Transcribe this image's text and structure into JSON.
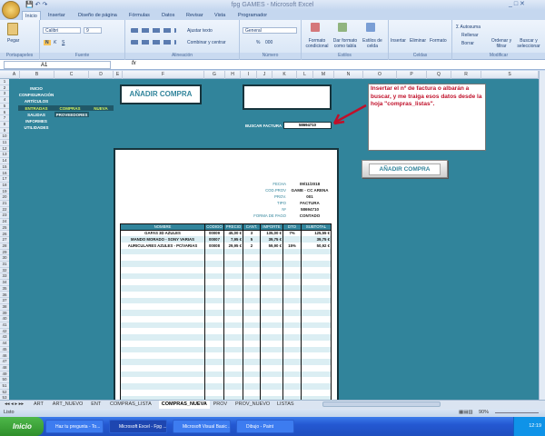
{
  "window": {
    "title": "fpg GAMES - Microsoft Excel"
  },
  "ribbon": {
    "tabs": [
      "Inicio",
      "Insertar",
      "Diseño de página",
      "Fórmulas",
      "Datos",
      "Revisar",
      "Vista",
      "Programador"
    ],
    "active_tab": "Inicio",
    "clipboard": {
      "paste": "Pegar",
      "label": "Portapapeles"
    },
    "font": {
      "name": "Calibri",
      "size": "9",
      "label": "Fuente",
      "bold": "N",
      "italic": "K",
      "underline": "S"
    },
    "alignment": {
      "wrap": "Ajustar texto",
      "merge": "Combinar y centrar",
      "label": "Alineación"
    },
    "number": {
      "format": "General",
      "label": "Número",
      "percent": "%",
      "thousands": "000"
    },
    "styles": {
      "conditional": "Formato condicional",
      "as_table": "Dar formato como tabla",
      "cell_styles": "Estilos de celda",
      "label": "Estilos"
    },
    "cells": {
      "insert": "Insertar",
      "delete": "Eliminar",
      "format": "Formato",
      "label": "Celdas"
    },
    "editing": {
      "autosum": "Autosuma",
      "fill": "Rellenar",
      "clear": "Borrar",
      "sort": "Ordenar y filtrar",
      "find": "Buscar y seleccionar",
      "label": "Modificar"
    }
  },
  "formula_bar": {
    "name_box": "A1",
    "fx": "fx",
    "value": ""
  },
  "columns": [
    "A",
    "B",
    "C",
    "D",
    "E",
    "F",
    "G",
    "H",
    "I",
    "J",
    "K",
    "L",
    "M",
    "N",
    "O",
    "P",
    "Q",
    "R",
    "S"
  ],
  "row_count": 53,
  "menu": {
    "inicio": "INICIO",
    "configuracion": "CONFIGURACIÓN",
    "articulos": "ARTÍCULOS",
    "entradas": "ENTRADAS",
    "compras": "COMPRAS",
    "nueva": "NUEVA",
    "salidas": "SALIDAS",
    "proveedores": "PROVEEDORES",
    "informes": "INFORMES",
    "utilidades": "UTILIDADES"
  },
  "header_button": "AÑADIR COMPRA",
  "search": {
    "label": "BUSCAR FACTURA",
    "value": "58694710"
  },
  "note": "Insertar el nº de factura o albarán a buscar, y me traiga esos datos desde la hoja \"compras_listas\".",
  "add_button": "AÑADIR COMPRA",
  "invoice": {
    "fields": [
      {
        "label": "FECHA",
        "value": "09/11/2018"
      },
      {
        "label": "COD.PROV",
        "value": "GAME - CC ARENA"
      },
      {
        "label": "PROV.",
        "value": "001"
      },
      {
        "label": "TIPO",
        "value": "FACTURA"
      },
      {
        "label": "Nº",
        "value": "58694710"
      },
      {
        "label": "FORMA DE PAGO",
        "value": "CONTADO"
      }
    ],
    "columns": [
      "NOMBRE",
      "CODIGO",
      "PRECIO",
      "CANT.",
      "IMPORTE",
      "DTO",
      "SUBTOTAL"
    ],
    "rows": [
      [
        "GAFAS 3D AZULES",
        "00009",
        "45,00 €",
        "3",
        "135,00 €",
        "7%",
        "125,55 €"
      ],
      [
        "MANDO MORADO - SONY VARIAS",
        "00007",
        "7,95 €",
        "5",
        "39,75 €",
        "",
        "39,75 €"
      ],
      [
        "AURICULARES AZULES - PC/VARIAS",
        "00008",
        "29,95 €",
        "2",
        "59,90 €",
        "15%",
        "50,92 €"
      ]
    ],
    "empty_rows": 26
  },
  "sheet_tabs": [
    "ART",
    "ART_NUEVO",
    "ENT",
    "COMPRAS_LISTA",
    "COMPRAS_NUEVA",
    "PROV",
    "PROV_NUEVO",
    "LISTAS"
  ],
  "active_sheet": "COMPRAS_NUEVA",
  "status": {
    "text": "Listo",
    "zoom": "90%"
  },
  "taskbar": {
    "start": "Inicio",
    "tasks": [
      "Haz tu pregunta - To...",
      "Microsoft Excel - Fpg ...",
      "Microsoft Visual Basic ...",
      "Dibujo - Paint"
    ],
    "active_task": 1,
    "clock": "12:19"
  }
}
